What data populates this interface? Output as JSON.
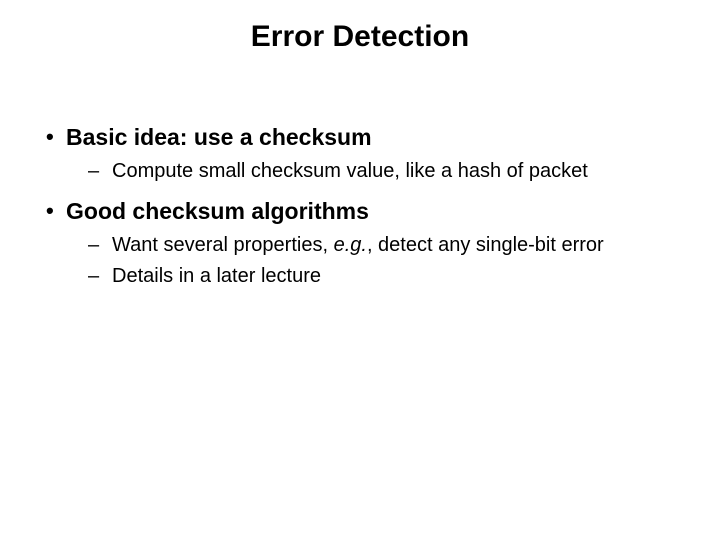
{
  "slide": {
    "title": "Error Detection",
    "bullets": [
      {
        "text": "Basic idea: use a checksum",
        "sub": [
          {
            "text": "Compute small checksum value, like a hash of packet"
          }
        ]
      },
      {
        "text": "Good checksum algorithms",
        "sub": [
          {
            "prefix": "Want several properties, ",
            "italic": "e.g.",
            "suffix": ", detect any single-bit error"
          },
          {
            "text": "Details in a later lecture"
          }
        ]
      }
    ]
  }
}
